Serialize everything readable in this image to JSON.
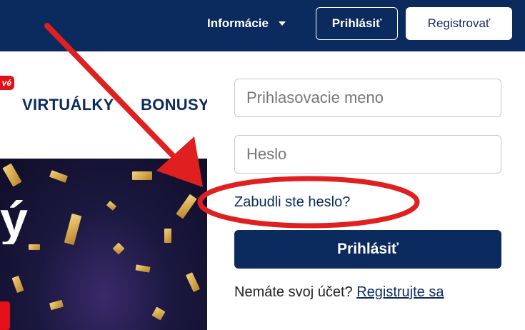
{
  "header": {
    "info_menu_label": "Informácie",
    "login_label": "Prihlásiť",
    "register_label": "Registrovať"
  },
  "nav": {
    "badge": "vé",
    "items": [
      "VIRTUÁLKY",
      "BONUSY"
    ]
  },
  "hero": {
    "glyph": "ý"
  },
  "login_form": {
    "username_placeholder": "Prihlasovacie meno",
    "password_placeholder": "Heslo",
    "forgot_label": "Zabudli ste heslo?",
    "submit_label": "Prihlásiť",
    "no_account_text": "Nemáte svoj účet?",
    "register_link": "Registrujte sa"
  },
  "annotation": {
    "arrow_color": "#e02020",
    "ellipse_color": "#e02020"
  },
  "colors": {
    "brand": "#0b2a5e",
    "accent_red": "#e3101a"
  }
}
